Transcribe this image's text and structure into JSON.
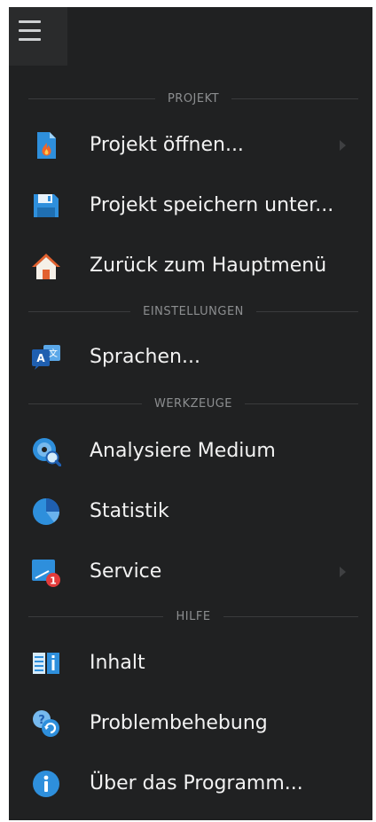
{
  "menu": {
    "sections": [
      {
        "title": "PROJEKT",
        "items": [
          {
            "label": "Projekt öffnen...",
            "icon": "file-fire-icon",
            "submenu": true
          },
          {
            "label": "Projekt speichern unter...",
            "icon": "floppy-disk-icon",
            "submenu": false
          },
          {
            "label": "Zurück zum Hauptmenü",
            "icon": "home-icon",
            "submenu": false
          }
        ]
      },
      {
        "title": "EINSTELLUNGEN",
        "items": [
          {
            "label": "Sprachen...",
            "icon": "translate-icon",
            "submenu": false
          }
        ]
      },
      {
        "title": "WERKZEUGE",
        "items": [
          {
            "label": "Analysiere Medium",
            "icon": "disc-magnifier-icon",
            "submenu": false
          },
          {
            "label": "Statistik",
            "icon": "pie-chart-icon",
            "submenu": false
          },
          {
            "label": "Service",
            "icon": "service-badge-icon",
            "submenu": true,
            "badge": "1"
          }
        ]
      },
      {
        "title": "HILFE",
        "items": [
          {
            "label": "Inhalt",
            "icon": "book-info-icon",
            "submenu": false
          },
          {
            "label": "Problembehebung",
            "icon": "troubleshoot-chat-icon",
            "submenu": false
          },
          {
            "label": "Über das Programm...",
            "icon": "info-circle-icon",
            "submenu": false
          }
        ]
      }
    ]
  },
  "colors": {
    "background": "#202122",
    "text": "#f2f2f2",
    "section_text": "#8c8e90",
    "accent_blue": "#2e8fdc",
    "badge_red": "#e23b3b",
    "home_orange": "#e2612f"
  }
}
